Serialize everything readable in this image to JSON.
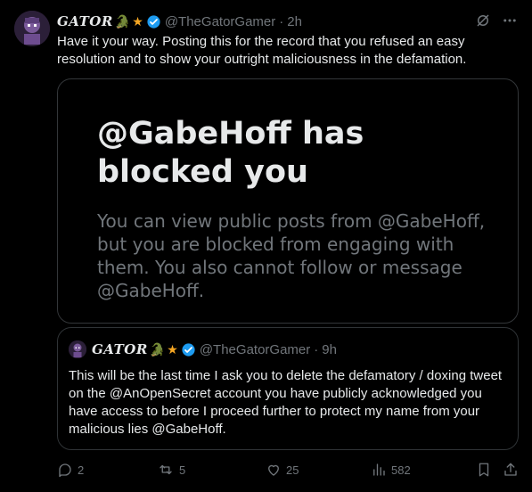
{
  "post": {
    "display_name": "GATOR",
    "emoji_gator": "🐊",
    "emoji_star": "★",
    "handle": "@TheGatorGamer",
    "separator": "·",
    "time": "2h",
    "text": "Have it your way. Posting this for the record that you refused an easy resolution and to show your outright maliciousness in the defamation."
  },
  "card": {
    "title": "@GabeHoff has blocked you",
    "body": "You can view public posts from @GabeHoff, but you are blocked from engaging with them. You also cannot follow or message @GabeHoff."
  },
  "quote": {
    "display_name": "GATOR",
    "emoji_gator": "🐊",
    "emoji_star": "★",
    "handle": "@TheGatorGamer",
    "separator": "·",
    "time": "9h",
    "text": "This will be the last time I ask you to delete the defamatory / doxing tweet on the @AnOpenSecret account you have publicly acknowledged you have access to before I proceed further to protect my name from your malicious lies @GabeHoff."
  },
  "actions": {
    "replies": "2",
    "reposts": "5",
    "likes": "25",
    "views": "582"
  },
  "colors": {
    "background": "#000000",
    "text": "#e7e9ea",
    "muted": "#71767b",
    "verified": "#1d9bf0",
    "border": "#333639"
  }
}
